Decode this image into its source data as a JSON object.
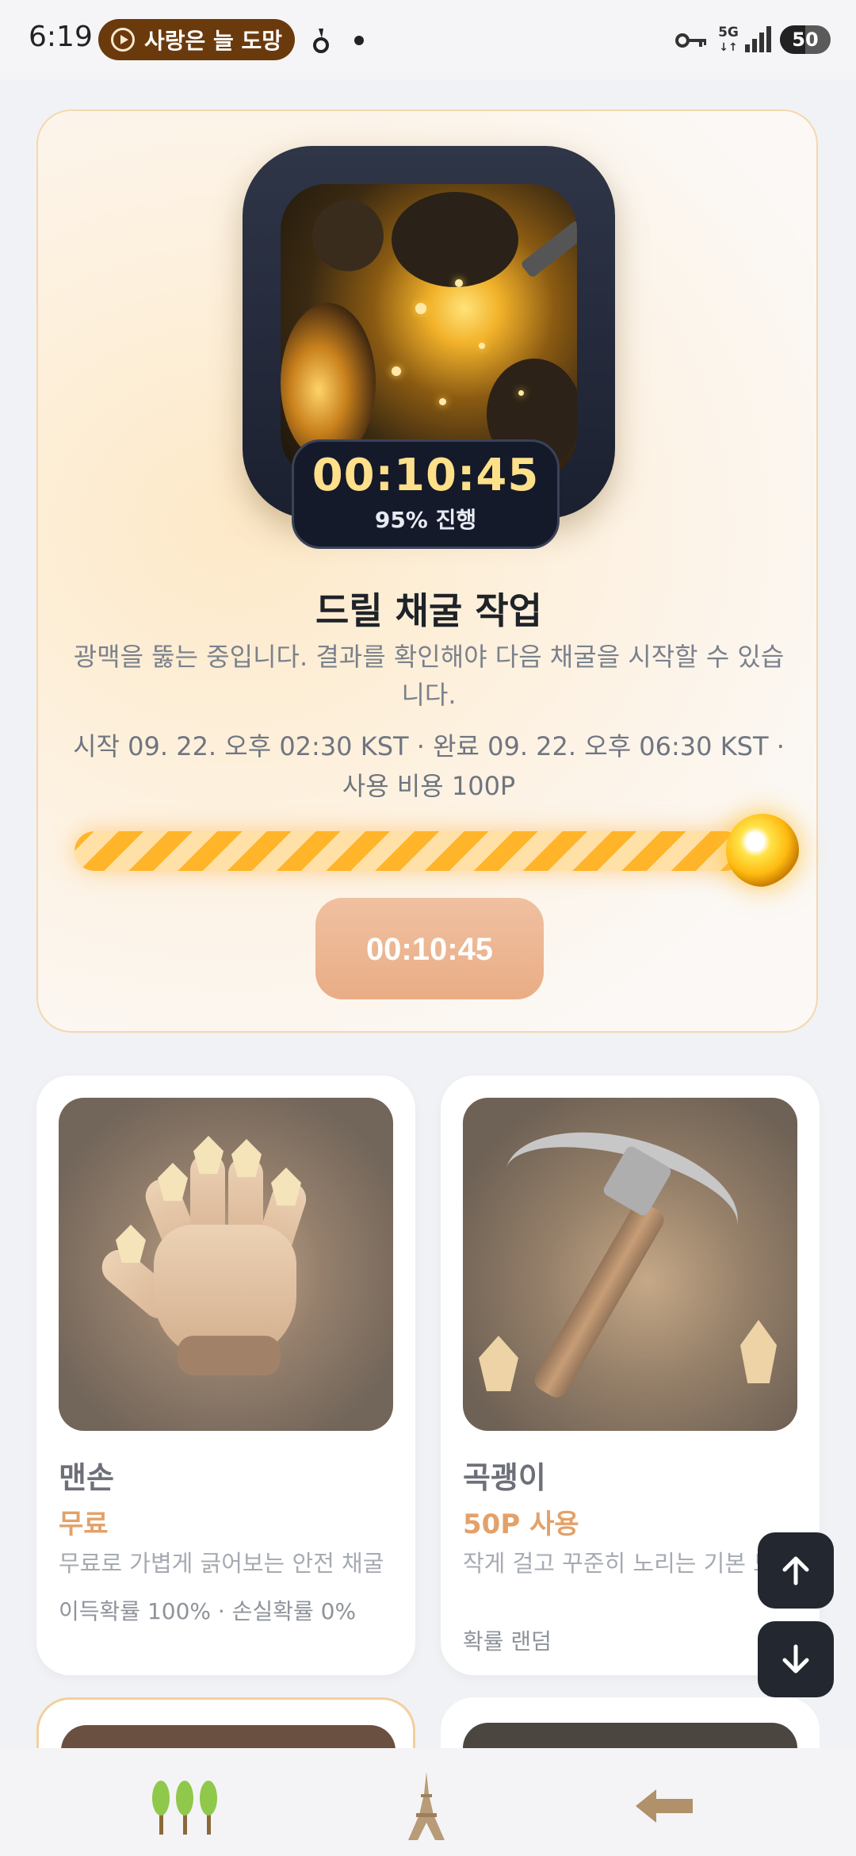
{
  "status_bar": {
    "time": "6:19",
    "music_text": "사랑은 늘 도망",
    "network": "5G",
    "battery": "50"
  },
  "job": {
    "timer": "00:10:45",
    "progress_text": "95% 진행",
    "progress": 0.95,
    "title": "드릴 채굴 작업",
    "description": "광맥을 뚫는 중입니다. 결과를 확인해야 다음 채굴을 시작할 수 있습니다.",
    "meta": "시작 09. 22. 오후 02:30 KST · 완료 09. 22. 오후 06:30 KST · 사용 비용 100P",
    "button_label": "00:10:45"
  },
  "tools": [
    {
      "name": "맨손",
      "price": "무료",
      "description": "무료로 가볍게 긁어보는 안전 채굴",
      "stats": "이득확률 100% · 손실확률 0%"
    },
    {
      "name": "곡괭이",
      "price": "50P 사용",
      "description": "작게 걸고 꾸준히 노리는 기본 도구",
      "stats": "확률 랜덤"
    }
  ],
  "colors": {
    "accent_orange": "#e3a16a",
    "progress_stripe": "#ffb429",
    "timer_gold": "#ffe08a",
    "dark_plate": "#141a2a"
  },
  "fab": {
    "up_icon": "arrow-up-icon",
    "down_icon": "arrow-down-icon"
  },
  "bottom_nav": {
    "items": [
      "trees-icon",
      "eiffel-tower-icon",
      "back-arrow-icon"
    ]
  }
}
